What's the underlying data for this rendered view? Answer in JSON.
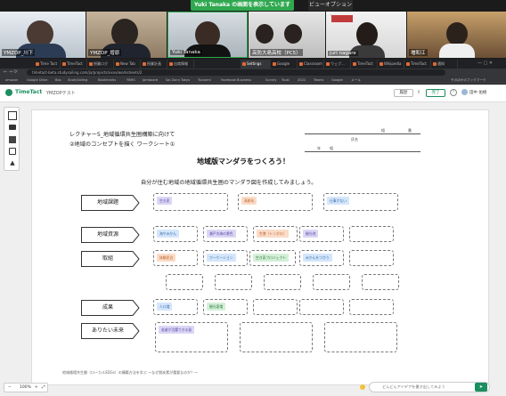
{
  "meeting": {
    "share_banner": "Yuki Tanaka の画面を表示しています",
    "view_option": "ビューオプション ▾",
    "participants": [
      "YMZOP_川下",
      "YMZOP_增原",
      "Yuki Tanaka",
      "高防大島高校（PC5）",
      "juri nagare",
      "増和江"
    ]
  },
  "browser": {
    "tabs": [
      "Time Tact",
      "TimeTact",
      "授業ログ",
      "New Tab",
      "授業計画",
      "出席情報",
      "Settings",
      "Google",
      "Classroom",
      "ウェブ…",
      "TimeTact",
      "Wikipedia",
      "TimeTact",
      "通知"
    ],
    "url": "timetact-beta.studysailing.com/ja/projects/xxxx/worksheets/2",
    "bookmarks": [
      "amazon",
      "Google Drive",
      "Box",
      "StudySailing",
      "Bookmarks",
      "YBHS",
      "Jamboard",
      "Sai Zonn Tokyo",
      "Tsunami",
      "Facebook Business",
      "Survey",
      "Tsuki",
      "2022",
      "Teams",
      "Google",
      "メール",
      "そのほかのブックマーク"
    ]
  },
  "app": {
    "logo": "TimeTact",
    "doc_title": "YMZOPテスト",
    "header_buttons": [
      "履歴",
      "完了",
      "田中 佑樹"
    ],
    "sidebar_icons": [
      "expand-icon",
      "comment-icon",
      "sticky-note-icon",
      "shape-icon",
      "upload-icon"
    ]
  },
  "worksheet": {
    "lecture": "レクチャー5_地域循環共生圏構築に向けて",
    "subtitle": "②地域のコンセプトを描く ワークシート①",
    "meta_labels": {
      "group": "組",
      "number": "番",
      "grade": "年",
      "class": "組",
      "name": "氏名"
    },
    "title": "地域版マンダラをつくろう！",
    "instruction": "自分が住む地域の地域循環共生圏のマンダラ図を作成してみましょう。",
    "rows": [
      {
        "label": "地域課題",
        "stickies": [
          "空き家",
          "高齢化",
          "仕事がない"
        ]
      },
      {
        "label": "地域資源",
        "stickies": [
          "海やみかん",
          "瀬戸内海の景色",
          "空港（トンボロ）",
          "観光地"
        ]
      },
      {
        "label": "取組",
        "stickies": [
          "体験民泊",
          "ワーケーション",
          "空き家プロジェクト",
          "みかんをつかう"
        ]
      },
      {
        "label": "成果",
        "stickies": [
          "人口増",
          "観光客増"
        ]
      },
      {
        "label": "ありたい未来",
        "stickies": [
          "若者が活躍できる島"
        ]
      }
    ],
    "footer": "地域循環共生圏（ローカルSDGs）の構築方法を学ぶ 〜なぜ脱炭素が重要なのか？〜"
  },
  "bottom": {
    "zoom": "100%",
    "idea_placeholder": "どんどんアイデアを書き出してみよう"
  },
  "colors": {
    "accent": "#1c8f5f",
    "sticky_purple": "#dcd6f5",
    "sticky_blue": "#d4e6fb",
    "sticky_orange": "#fbdcc8",
    "sticky_green": "#d4f0d8"
  }
}
